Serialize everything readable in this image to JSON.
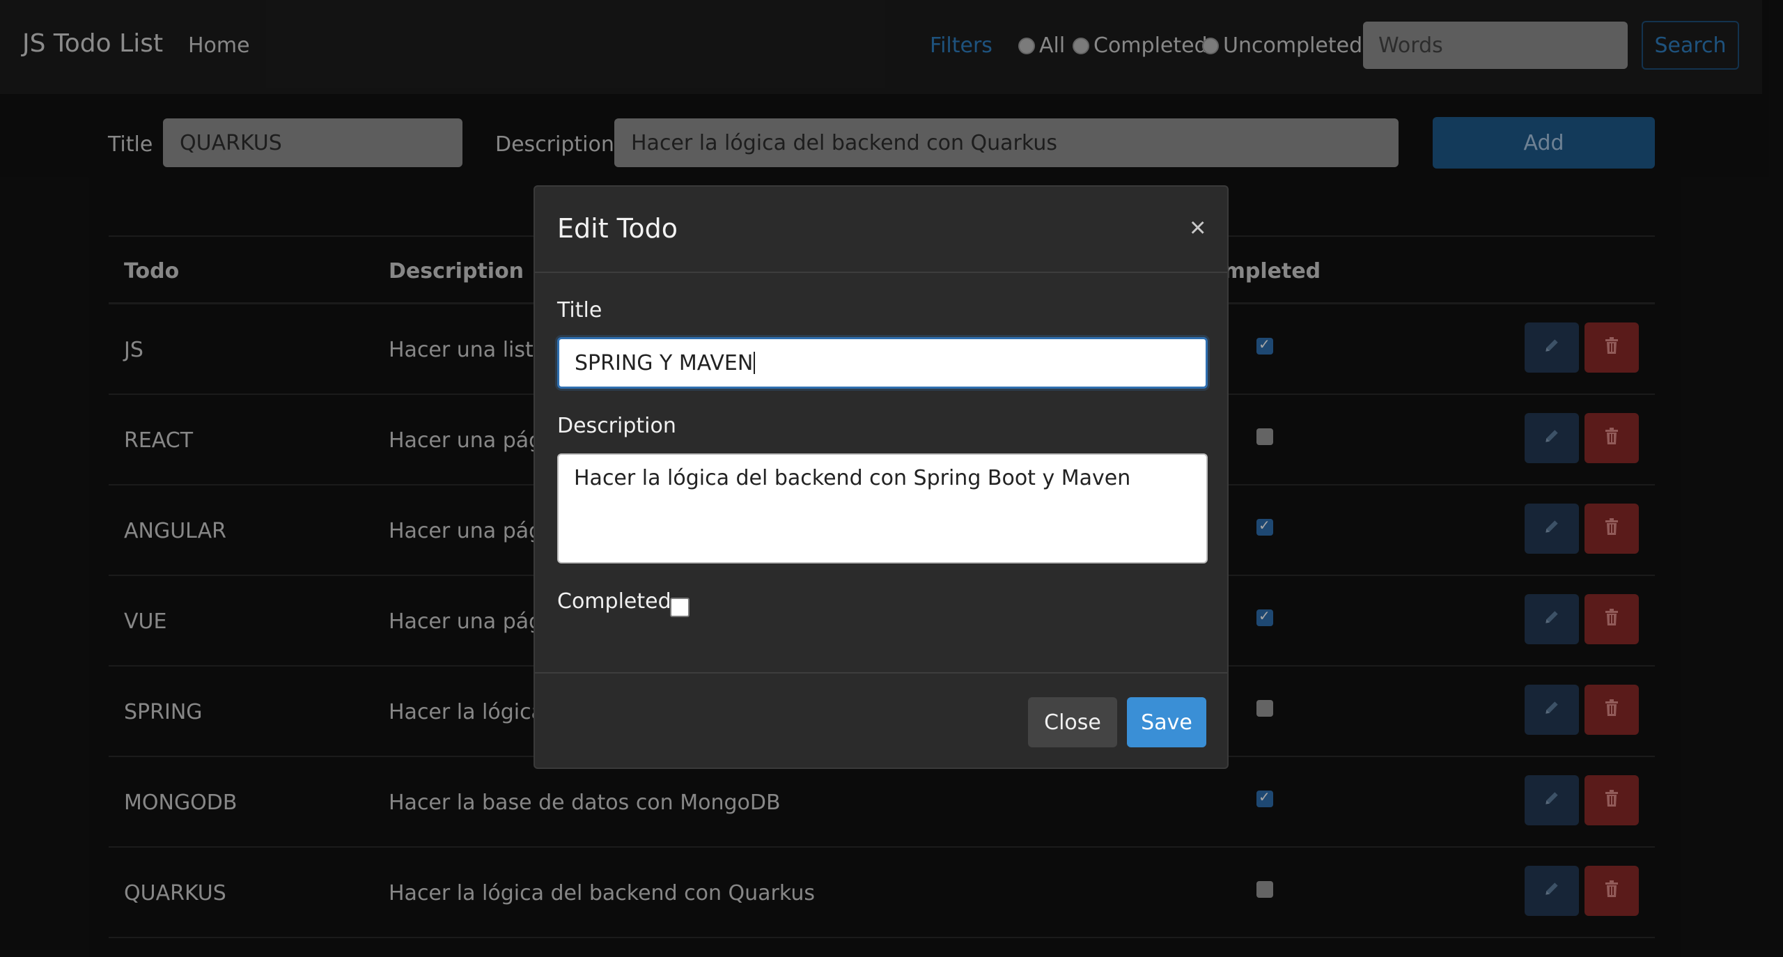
{
  "navbar": {
    "brand": "JS Todo List",
    "home": "Home",
    "filters_label": "Filters",
    "radio_all": "All",
    "radio_completed": "Completed",
    "radio_uncompleted": "Uncompleted",
    "search_placeholder": "Words",
    "search_button": "Search"
  },
  "add_form": {
    "title_label": "Title",
    "title_value": "QUARKUS",
    "description_label": "Description",
    "description_value": "Hacer la lógica del backend con Quarkus",
    "add_button": "Add"
  },
  "table": {
    "headers": {
      "todo": "Todo",
      "description": "Description",
      "completed": "ompleted"
    },
    "rows": [
      {
        "todo": "JS",
        "description": "Hacer una lista c",
        "completed": true
      },
      {
        "todo": "REACT",
        "description": "Hacer una págin",
        "completed": false
      },
      {
        "todo": "ANGULAR",
        "description": "Hacer una págin",
        "completed": true
      },
      {
        "todo": "VUE",
        "description": "Hacer una págin",
        "completed": true
      },
      {
        "todo": "SPRING",
        "description": "Hacer la lógica c",
        "completed": false
      },
      {
        "todo": "MONGODB",
        "description": "Hacer la base de datos con MongoDB",
        "completed": true
      },
      {
        "todo": "QUARKUS",
        "description": "Hacer la lógica del backend con Quarkus",
        "completed": false
      }
    ]
  },
  "modal": {
    "title": "Edit Todo",
    "close_glyph": "×",
    "title_label": "Title",
    "title_value": "SPRING Y MAVEN",
    "description_label": "Description",
    "description_value": "Hacer la lógica del backend con Spring Boot y Maven",
    "completed_label": "Completed",
    "completed": false,
    "close_button": "Close",
    "save_button": "Save"
  },
  "icons": {
    "edit": "pencil-icon",
    "delete": "trash-icon"
  },
  "colors": {
    "accent": "#2f7fc1",
    "save": "#3a8fd6",
    "delete": "#8b2a28",
    "edit": "#243a55"
  }
}
